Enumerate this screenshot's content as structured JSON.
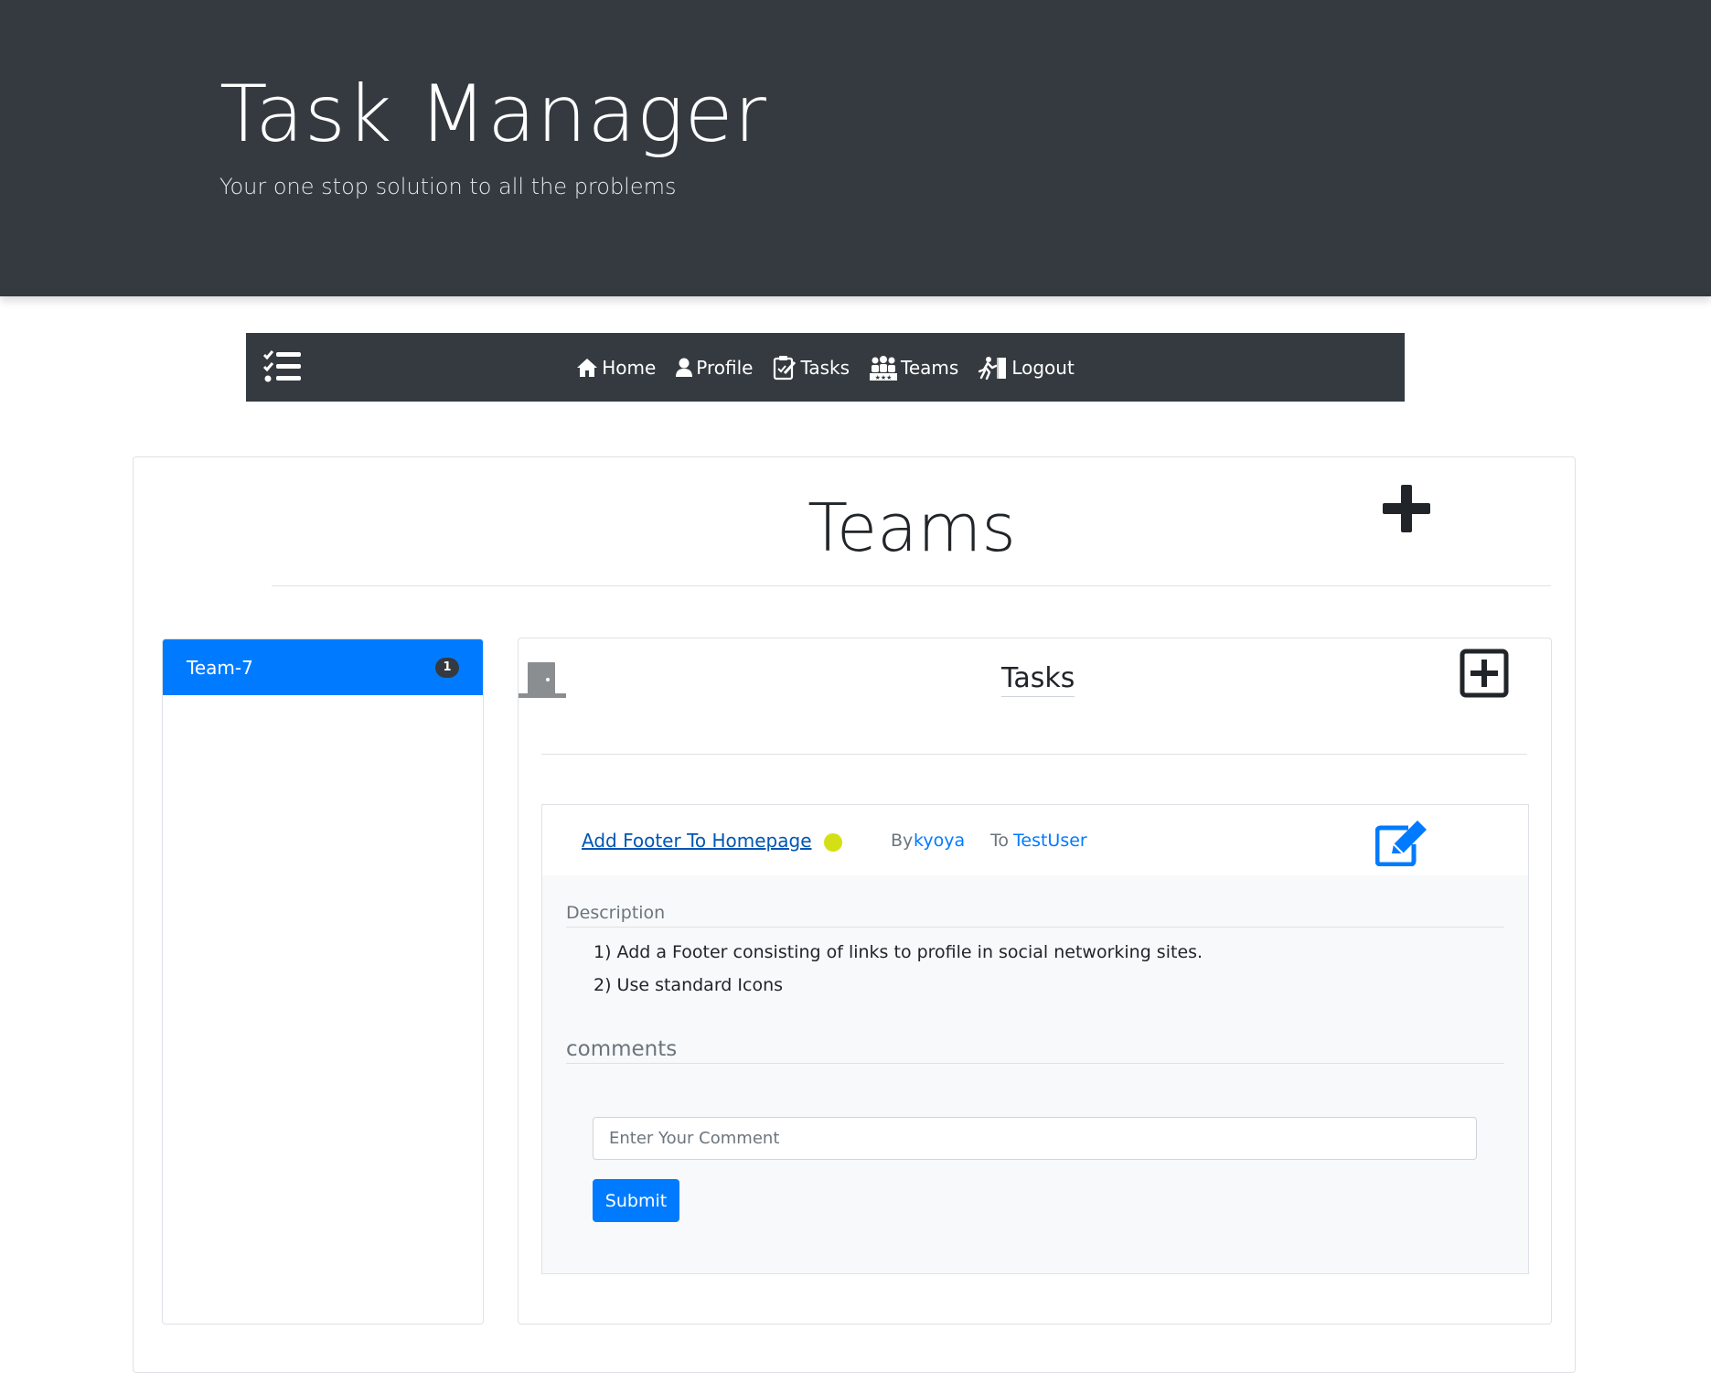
{
  "hero": {
    "title": "Task Manager",
    "subtitle": "Your one stop solution to all the problems"
  },
  "navbar": {
    "brand_icon": "task-list-icon",
    "items": [
      {
        "label": "Home",
        "icon": "home-icon"
      },
      {
        "label": "Profile",
        "icon": "user-icon"
      },
      {
        "label": "Tasks",
        "icon": "clipboard-icon"
      },
      {
        "label": "Teams",
        "icon": "users-icon"
      },
      {
        "label": "Logout",
        "icon": "running-exit-icon"
      }
    ]
  },
  "page": {
    "title": "Teams",
    "add_team_icon": "plus-icon"
  },
  "teams": [
    {
      "name": "Team-7",
      "count": "1",
      "active": true
    }
  ],
  "tasks_panel": {
    "title": "Tasks",
    "leave_icon": "door-icon",
    "add_task_icon": "plus-square-icon"
  },
  "task": {
    "title": "Add Footer To Homepage",
    "status_color": "#d4e015",
    "by_label": "By",
    "by_user": "kyoya",
    "to_label": "To",
    "to_user": "TestUser",
    "edit_icon": "edit-icon",
    "description_label": "Description",
    "description_lines": [
      "1) Add a Footer consisting of links to profile in social networking sites.",
      "2) Use standard Icons"
    ],
    "comments_label": "comments",
    "comment_placeholder": "Enter Your Comment",
    "submit_label": "Submit"
  },
  "colors": {
    "dark": "#343a40",
    "primary": "#007bff",
    "muted": "#6c757d",
    "light": "#f8f9fa"
  }
}
